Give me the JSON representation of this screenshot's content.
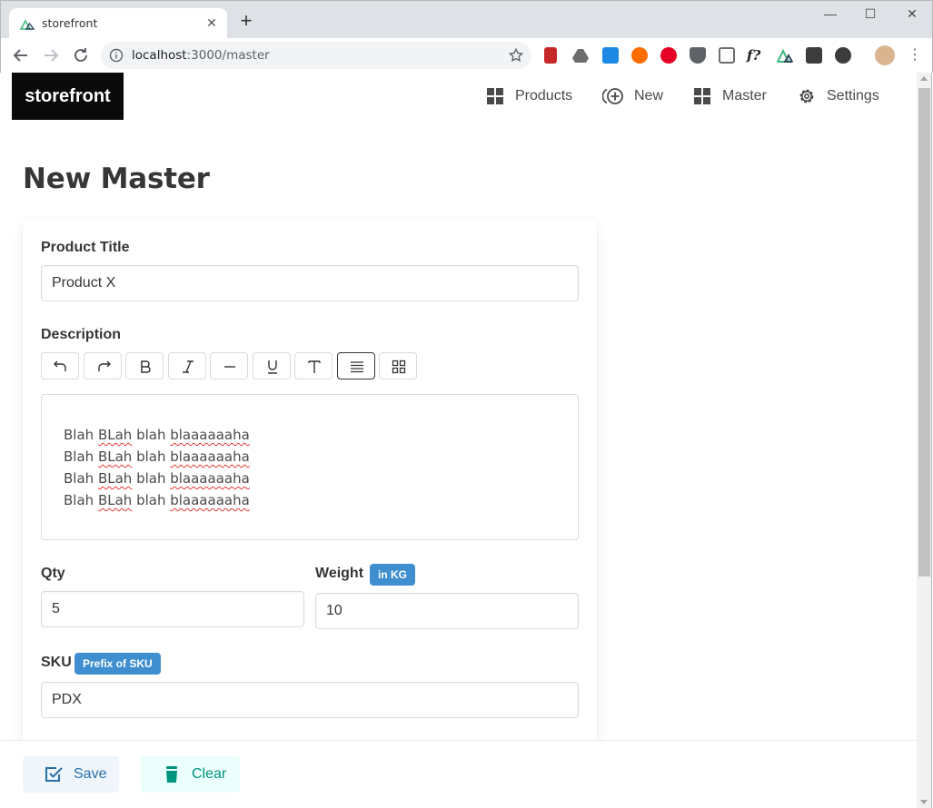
{
  "browser": {
    "tab_title": "storefront",
    "url_host": "localhost",
    "url_rest": ":3000/master"
  },
  "header": {
    "brand": "storefront",
    "nav": [
      {
        "label": "Products",
        "icon": "grid-icon"
      },
      {
        "label": "New",
        "icon": "plus-circle-icon"
      },
      {
        "label": "Master",
        "icon": "grid-icon"
      },
      {
        "label": "Settings",
        "icon": "gear-icon"
      }
    ]
  },
  "page": {
    "title": "New Master"
  },
  "form": {
    "product_title": {
      "label": "Product Title",
      "value": "Product X"
    },
    "description": {
      "label": "Description",
      "lines": [
        [
          "Blah ",
          "BLah",
          " blah ",
          "blaaaaaaha"
        ],
        [
          "Blah ",
          "BLah",
          " blah ",
          "blaaaaaaha"
        ],
        [
          "Blah ",
          "BLah",
          " blah ",
          "blaaaaaaha"
        ],
        [
          "Blah ",
          "BLah",
          " blah ",
          "blaaaaaaha"
        ]
      ]
    },
    "qty": {
      "label": "Qty",
      "value": "5"
    },
    "weight": {
      "label": "Weight",
      "tag": "in KG",
      "value": "10"
    },
    "sku": {
      "label": "SKU",
      "tag": "Prefix of SKU",
      "value": "PDX"
    }
  },
  "footer": {
    "save_label": "Save",
    "clear_label": "Clear"
  },
  "colors": {
    "tag_blue": "#3e8ed0",
    "save_bg": "#eff5fb",
    "save_fg": "#296fa8",
    "clear_bg": "#ebfffc",
    "clear_fg": "#00947e"
  }
}
